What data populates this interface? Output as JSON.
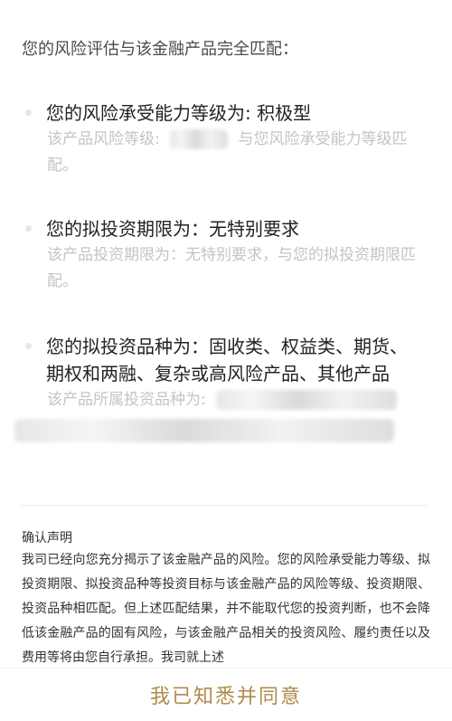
{
  "intro": "您的风险评估与该金融产品完全匹配：",
  "items": [
    {
      "main": "您的风险承受能力等级为: 积极型",
      "sub_prefix": "该产品风险等级:",
      "sub_suffix": "与您风险承受能力等级匹",
      "sub_tail": "配。"
    },
    {
      "main": "您的拟投资期限为：无特别要求",
      "sub": "该产品投资期限为：无特别要求，与您的拟投资期限匹配。"
    },
    {
      "main": "您的拟投资品种为：固收类、权益类、期货、期权和两融、复杂或高风险产品、其他产品",
      "sub_prefix": "该产品所属投资品种为:"
    }
  ],
  "statement": {
    "title": "确认声明",
    "body": "我司已经向您充分揭示了该金融产品的风险。您的风险承受能力等级、拟投资期限、拟投资品种等投资目标与该金融产品的风险等级、投资期限、投资品种相匹配。但上述匹配结果，并不能取代您的投资判断，也不会降低该金融产品的固有风险，与该金融产品相关的投资风险、履约责任以及费用等将由您自行承担。我司就上述"
  },
  "agree_button": "我已知悉并同意",
  "colors": {
    "accent": "#b08a4a",
    "sub_text": "#c4c4c4"
  }
}
